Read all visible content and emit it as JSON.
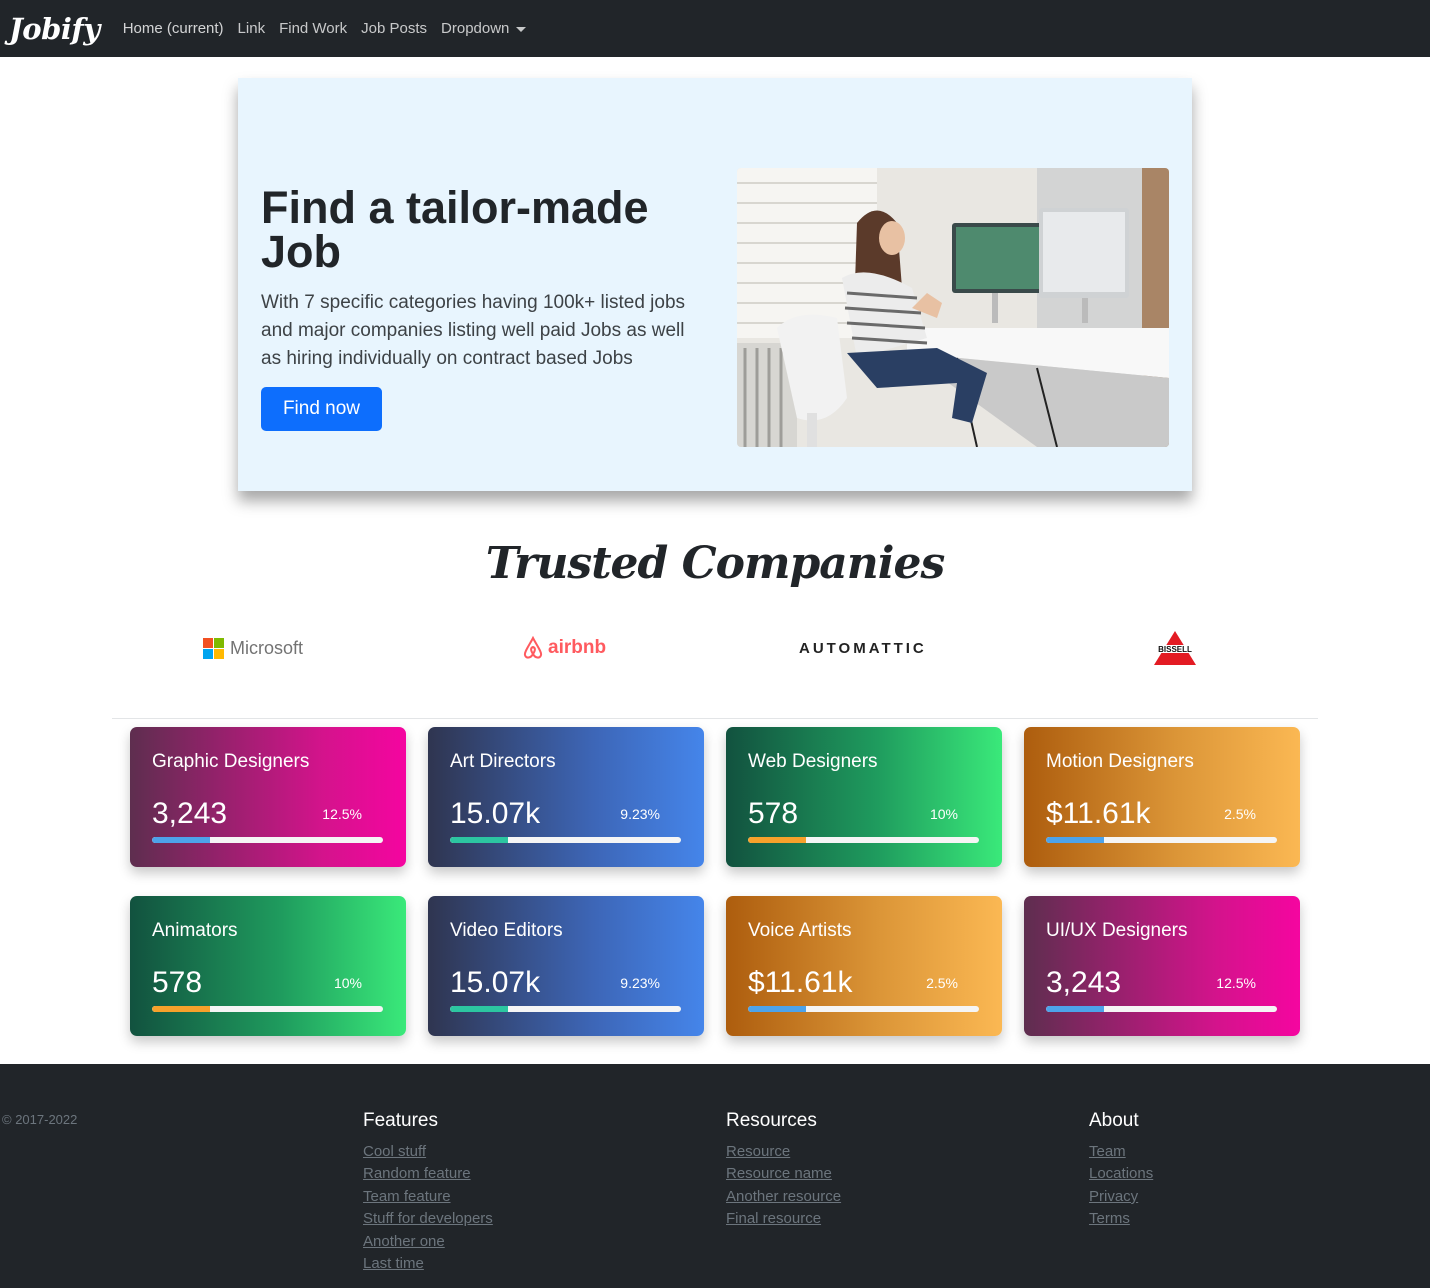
{
  "navbar": {
    "brand": "Jobify",
    "links": [
      "Home (current)",
      "Link",
      "Find Work",
      "Job Posts"
    ],
    "dropdown": "Dropdown"
  },
  "hero": {
    "title": "Find a tailor-made Job",
    "text": "With 7 specific categories having 100k+ listed jobs and major companies listing well paid Jobs as well as hiring individually on contract based Jobs",
    "button": "Find now",
    "image": "woman-working-at-desk-photo"
  },
  "trusted": {
    "title": "Trusted Companies",
    "logos": [
      "Microsoft",
      "airbnb",
      "AUTOMATTIC",
      "BISSELL"
    ]
  },
  "cards": [
    {
      "title": "Graphic Designers",
      "value": "3,243",
      "pct": "12.5%",
      "progress": 0.25,
      "gradient": "pink",
      "bar_color": "#4da3ea"
    },
    {
      "title": "Art Directors",
      "value": "15.07k",
      "pct": "9.23%",
      "progress": 0.25,
      "gradient": "blue",
      "bar_color": "#2cc6a1"
    },
    {
      "title": "Web Designers",
      "value": "578",
      "pct": "10%",
      "progress": 0.25,
      "gradient": "green",
      "bar_color": "#f7a12b"
    },
    {
      "title": "Motion Designers",
      "value": "$11.61k",
      "pct": "2.5%",
      "progress": 0.25,
      "gradient": "orange",
      "bar_color": "#4da3ea"
    },
    {
      "title": "Animators",
      "value": "578",
      "pct": "10%",
      "progress": 0.25,
      "gradient": "green",
      "bar_color": "#f7a12b"
    },
    {
      "title": "Video Editors",
      "value": "15.07k",
      "pct": "9.23%",
      "progress": 0.25,
      "gradient": "blue",
      "bar_color": "#2cc6a1"
    },
    {
      "title": "Voice Artists",
      "value": "$11.61k",
      "pct": "2.5%",
      "progress": 0.25,
      "gradient": "orange",
      "bar_color": "#4da3ea"
    },
    {
      "title": "UI/UX Designers",
      "value": "3,243",
      "pct": "12.5%",
      "progress": 0.25,
      "gradient": "pink",
      "bar_color": "#4da3ea"
    }
  ],
  "footer": {
    "copyright": "© 2017-2022",
    "columns": [
      {
        "heading": "Features",
        "links": [
          "Cool stuff",
          "Random feature",
          "Team feature",
          "Stuff for developers",
          "Another one",
          "Last time"
        ]
      },
      {
        "heading": "Resources",
        "links": [
          "Resource",
          "Resource name",
          "Another resource",
          "Final resource"
        ]
      },
      {
        "heading": "About",
        "links": [
          "Team",
          "Locations",
          "Privacy",
          "Terms"
        ]
      }
    ]
  }
}
